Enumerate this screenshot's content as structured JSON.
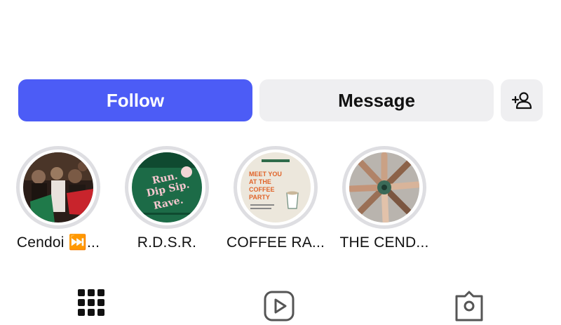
{
  "actions": {
    "follow_label": "Follow",
    "message_label": "Message",
    "add_user_icon": "person-plus-icon"
  },
  "highlights": [
    {
      "label": "Cendoi ⏭️..."
    },
    {
      "label": "R.D.S.R."
    },
    {
      "label": "COFFEE RA..."
    },
    {
      "label": "THE CEND..."
    }
  ],
  "highlight_art": {
    "poster2_line1": "Run.",
    "poster2_line2": "Dip Sip.",
    "poster2_line3": "Rave.",
    "poster3_line1": "MEET YOU",
    "poster3_line2": "AT THE",
    "poster3_line3": "COFFEE",
    "poster3_line4": "PARTY"
  },
  "tabs": [
    {
      "icon": "grid-icon"
    },
    {
      "icon": "reels-icon"
    },
    {
      "icon": "tagged-icon"
    }
  ],
  "colors": {
    "follow_bg": "#4c5cf6",
    "secondary_bg": "#efeff1",
    "ring": "#dedee2"
  }
}
